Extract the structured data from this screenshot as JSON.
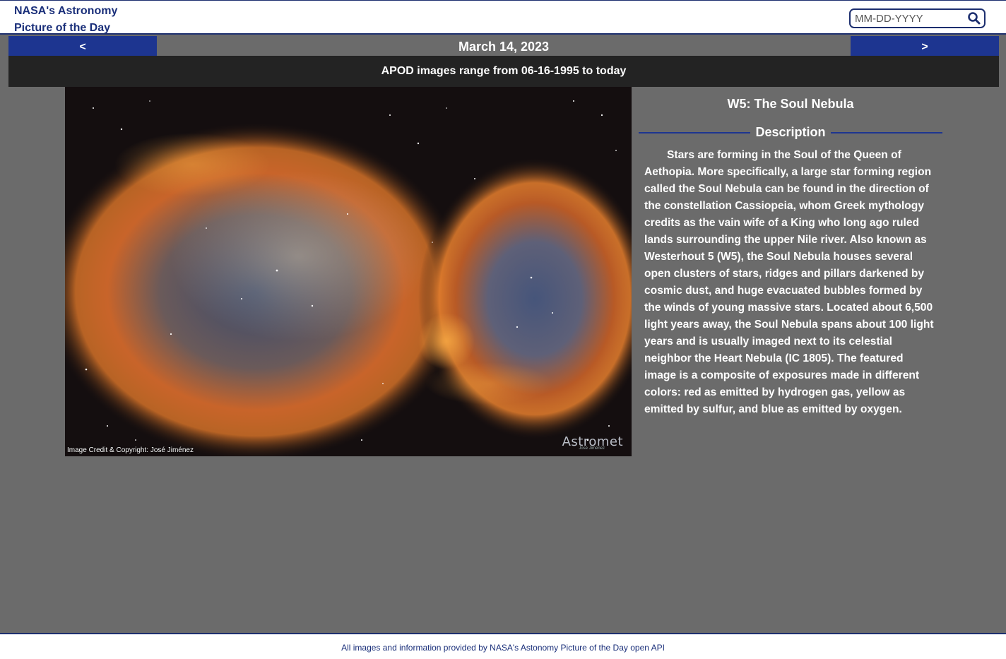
{
  "header": {
    "brand_line1": "NASA's Astronomy",
    "brand_line2": "Picture of the Day",
    "search_placeholder": "MM-DD-YYYY",
    "search_icon": "search-icon"
  },
  "datebar": {
    "prev_label": "<",
    "next_label": ">",
    "date": "March 14, 2023"
  },
  "range_notice": "APOD images range from 06-16-1995 to today",
  "image": {
    "credit": "Image Credit & Copyright: José Jiménez",
    "watermark": "Astromet",
    "watermark_sub": "José Jiménez"
  },
  "info": {
    "title": "W5: The Soul Nebula",
    "description_heading": "Description",
    "description": "Stars are forming in the Soul of the Queen of Aethopia. More specifically, a large star forming region called the Soul Nebula can be found in the direction of the constellation Cassiopeia, whom Greek mythology credits as the vain wife of a King who long ago ruled lands surrounding the upper Nile river. Also known as Westerhout 5 (W5), the Soul Nebula houses several open clusters of stars, ridges and pillars darkened by cosmic dust, and huge evacuated bubbles formed by the winds of young massive stars. Located about 6,500 light years away, the Soul Nebula spans about 100 light years and is usually imaged next to its celestial neighbor the Heart Nebula (IC 1805). The featured image is a composite of exposures made in different colors: red as emitted by hydrogen gas, yellow as emitted by sulfur, and blue as emitted by oxygen."
  },
  "footer": {
    "text": "All images and information provided by NASA's Astonomy Picture of the Day open API"
  },
  "colors": {
    "navy": "#1d3590",
    "background": "#6b6b6b",
    "range_bar": "#232323"
  }
}
